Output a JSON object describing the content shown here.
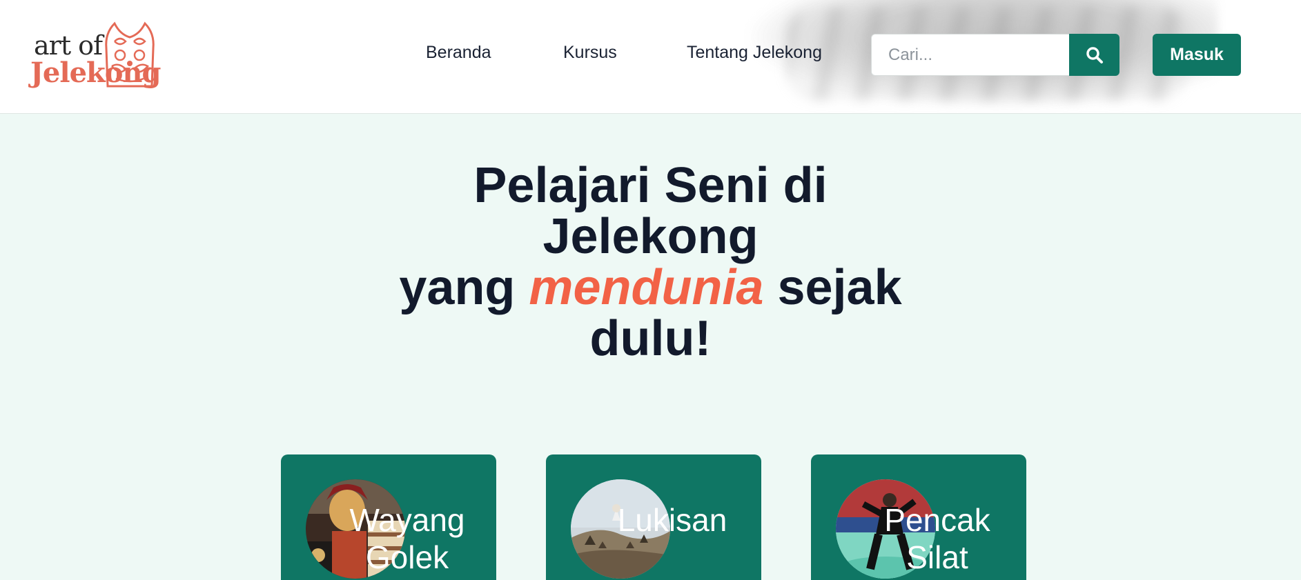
{
  "brand": {
    "logo_top": "art of",
    "logo_bottom": "Jelekong",
    "accent_color": "#e46a56"
  },
  "nav": {
    "items": [
      {
        "label": "Beranda"
      },
      {
        "label": "Kursus"
      },
      {
        "label": "Tentang Jelekong"
      }
    ]
  },
  "search": {
    "placeholder": "Cari...",
    "value": "",
    "icon": "search-icon"
  },
  "auth": {
    "login_label": "Masuk"
  },
  "hero": {
    "line1": "Pelajari Seni di",
    "line2": "Jelekong",
    "line3_pre": "yang ",
    "line3_accent": "mendunia",
    "line3_post": " sejak",
    "line4": "dulu!"
  },
  "cards": [
    {
      "title": "Wayang Golek"
    },
    {
      "title": "Lukisan"
    },
    {
      "title": "Pencak Silat"
    }
  ],
  "colors": {
    "primary": "#0f7664",
    "accent": "#f26246",
    "background": "#eef9f5",
    "text": "#121a2c"
  }
}
